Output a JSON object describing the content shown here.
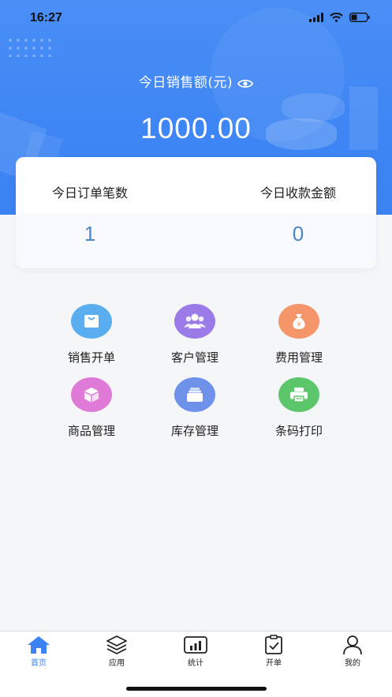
{
  "status_bar": {
    "time": "16:27"
  },
  "header": {
    "sales_label": "今日销售额(元)",
    "sales_amount": "1000.00"
  },
  "summary": {
    "orders_label": "今日订单笔数",
    "orders_value": "1",
    "collected_label": "今日收款金额",
    "collected_value": "0"
  },
  "menu": [
    {
      "label": "销售开单",
      "icon": "cart-icon",
      "color": "#5aaef0"
    },
    {
      "label": "客户管理",
      "icon": "users-icon",
      "color": "#9b7be8"
    },
    {
      "label": "费用管理",
      "icon": "money-bag-icon",
      "color": "#f5956a"
    },
    {
      "label": "商品管理",
      "icon": "box-icon",
      "color": "#e07ad8"
    },
    {
      "label": "库存管理",
      "icon": "inventory-icon",
      "color": "#6e92ea"
    },
    {
      "label": "条码打印",
      "icon": "printer-icon",
      "color": "#5cc66a"
    }
  ],
  "tabs": [
    {
      "label": "首页",
      "icon": "home-icon",
      "active": true
    },
    {
      "label": "应用",
      "icon": "layers-icon",
      "active": false
    },
    {
      "label": "统计",
      "icon": "bar-chart-icon",
      "active": false
    },
    {
      "label": "开单",
      "icon": "clipboard-check-icon",
      "active": false
    },
    {
      "label": "我的",
      "icon": "user-icon",
      "active": false
    }
  ],
  "colors": {
    "primary": "#3b82f2",
    "value_blue": "#4a86c8"
  }
}
